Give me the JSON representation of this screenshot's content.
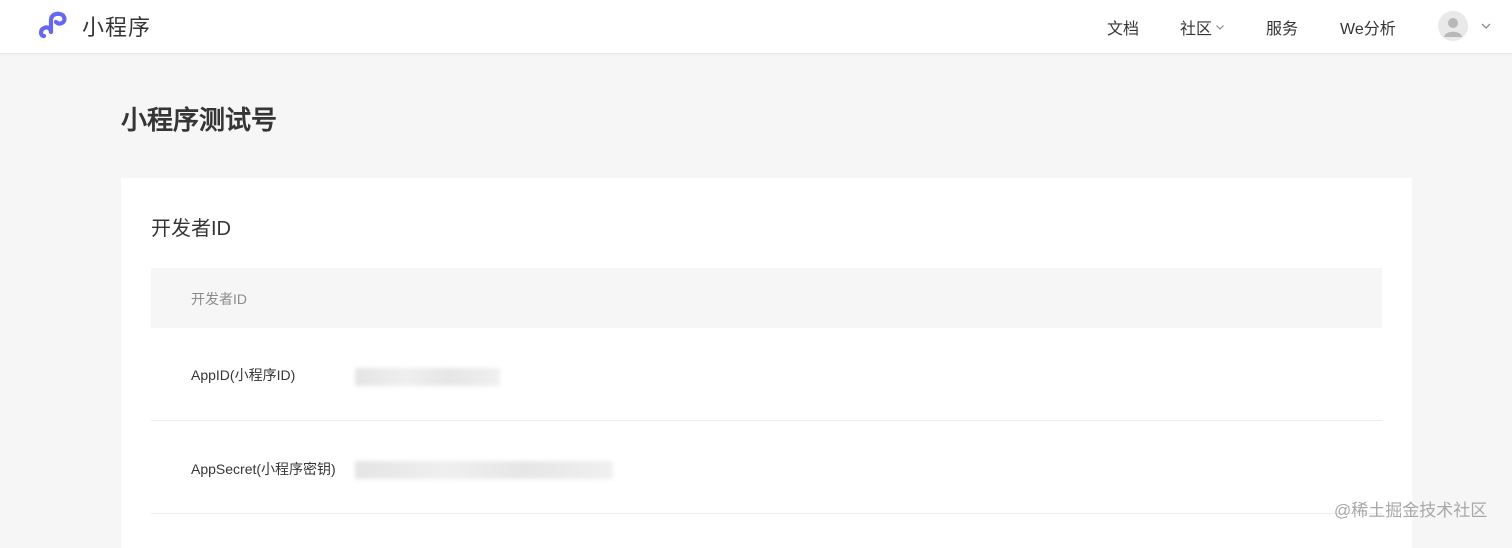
{
  "header": {
    "logo_text": "小程序",
    "logo_icon": "miniprogram-logo-icon",
    "nav": [
      {
        "label": "文档"
      },
      {
        "label": "社区",
        "has_dropdown": true
      },
      {
        "label": "服务"
      },
      {
        "label": "We分析"
      }
    ],
    "avatar_icon": "user-avatar-icon"
  },
  "page": {
    "title": "小程序测试号"
  },
  "card": {
    "title": "开发者ID",
    "table_header": "开发者ID",
    "rows": [
      {
        "label": "AppID(小程序ID)",
        "value_state": "blurred"
      },
      {
        "label": "AppSecret(小程序密钥)",
        "value_state": "blurred"
      }
    ]
  },
  "watermark": "@稀土掘金技术社区",
  "colors": {
    "brand": "#6467f0",
    "page_bg": "#f6f6f6",
    "text": "#353535",
    "muted": "#8c8c8c"
  }
}
